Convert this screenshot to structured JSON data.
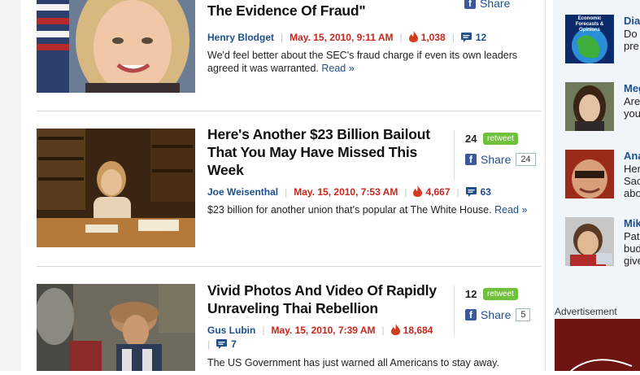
{
  "stories": [
    {
      "headline": "Case: \"I Have Serious Doubts About The Evidence Of Fraud\"",
      "author": "Henry Blodget",
      "date": "May. 15, 2010, 9:11 AM",
      "hits": "1,038",
      "comments": "12",
      "excerpt": "We'd feel better about the SEC's fraud charge if even its own leaders agreed it was warranted.",
      "read_more": "Read »",
      "share_label": "Share"
    },
    {
      "headline": "Here's Another $23 Billion Bailout That You May Have Missed This Week",
      "author": "Joe Weisenthal",
      "date": "May. 15, 2010, 7:53 AM",
      "hits": "4,667",
      "comments": "63",
      "excerpt": "$23 billion for another union that's popular at The White House.",
      "read_more": "Read »",
      "retweet_count": "24",
      "retweet_label": "retweet",
      "share_label": "Share",
      "share_count": "24"
    },
    {
      "headline": "Vivid Photos And Video Of Rapidly Unraveling Thai Rebellion",
      "author": "Gus Lubin",
      "date": "May. 15, 2010, 7:39 AM",
      "hits": "18,684",
      "comments": "7",
      "excerpt": "The US Government has just warned all Americans to stay away.",
      "retweet_count": "12",
      "retweet_label": "retweet",
      "share_label": "Share",
      "share_count": "5"
    }
  ],
  "sidebar": {
    "items": [
      {
        "name": "Dia",
        "lines": [
          "Do",
          "pre"
        ],
        "avatar_text": "Economic Forecasts & Opinions"
      },
      {
        "name": "Meg",
        "lines": [
          "Are",
          "you"
        ]
      },
      {
        "name": "Ana",
        "lines": [
          "Her",
          "Sac",
          "abo"
        ]
      },
      {
        "name": "Mik",
        "lines": [
          "Pat",
          "bud",
          "give"
        ]
      }
    ],
    "ad_label": "Advertisement"
  },
  "colors": {
    "accent_link": "#1f4f8b",
    "date_red": "#c8261d",
    "retweet_green": "#6fc03a",
    "facebook": "#3b5998"
  }
}
